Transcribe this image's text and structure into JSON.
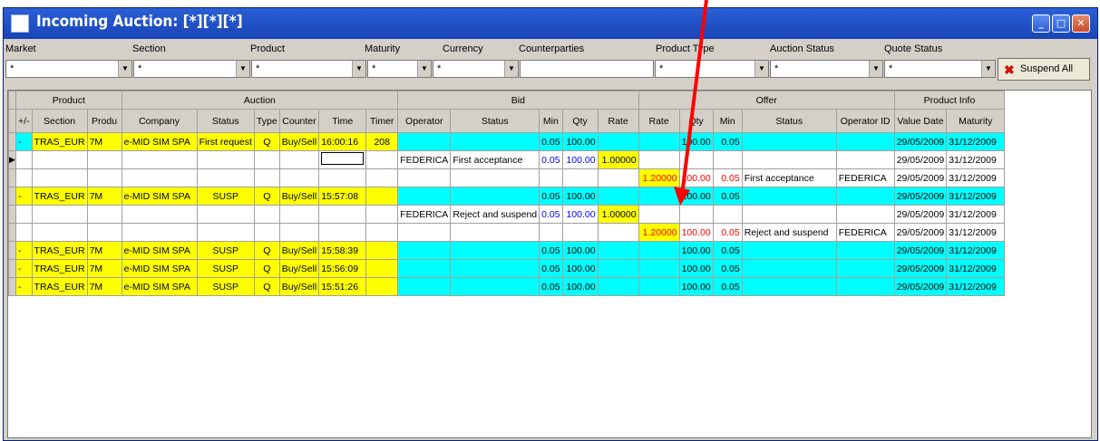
{
  "window": {
    "title": "Incoming Auction: [*][*][*]"
  },
  "filters": [
    {
      "label": "Market",
      "value": "*"
    },
    {
      "label": "Section",
      "value": "*"
    },
    {
      "label": "Product",
      "value": "*"
    },
    {
      "label": "Maturity",
      "value": "*"
    },
    {
      "label": "Currency",
      "value": "*"
    },
    {
      "label": "Counterparties",
      "value": ""
    },
    {
      "label": "Product Type",
      "value": "*"
    },
    {
      "label": "Auction Status",
      "value": "*"
    },
    {
      "label": "Quote Status",
      "value": "*"
    }
  ],
  "suspend_all": "Suspend All",
  "groups": {
    "product": "Product",
    "auction": "Auction",
    "bid": "Bid",
    "offer": "Offer",
    "product_info": "Product Info"
  },
  "columns": [
    "+/-",
    "Section",
    "Produ",
    "Company",
    "Status",
    "Type",
    "Counter",
    "Time",
    "Timer",
    "Operator",
    "Status",
    "Min",
    "Qty",
    "Rate",
    "Rate",
    "Qty",
    "Min",
    "Status",
    "Operator ID",
    "Value Date",
    "Maturity"
  ],
  "rows": [
    {
      "exp": "-",
      "section": "TRAS_EUR",
      "prod": "7M",
      "company": "e-MID SIM SPA",
      "status": "First request",
      "type": "Q",
      "counter": "Buy/Sell",
      "time": "16:00:16",
      "timer": "208",
      "operator": "",
      "bstatus": "",
      "bmin": "0.05",
      "bqty": "100.00",
      "brate": "",
      "orate": "",
      "oqty": "100.00",
      "omin": "0.05",
      "ostatus": "",
      "opid": "",
      "vdate": "29/05/2009",
      "mat": "31/12/2009"
    },
    {
      "exp": "",
      "section": "",
      "prod": "",
      "company": "",
      "status": "",
      "type": "",
      "counter": "",
      "time": "",
      "timer": "",
      "operator": "FEDERICA",
      "bstatus": "First acceptance",
      "bmin": "0.05",
      "bqty": "100.00",
      "brate": "1.00000",
      "orate": "",
      "oqty": "",
      "omin": "",
      "ostatus": "",
      "opid": "",
      "vdate": "29/05/2009",
      "mat": "31/12/2009"
    },
    {
      "exp": "",
      "section": "",
      "prod": "",
      "company": "",
      "status": "",
      "type": "",
      "counter": "",
      "time": "",
      "timer": "",
      "operator": "",
      "bstatus": "",
      "bmin": "",
      "bqty": "",
      "brate": "",
      "orate": "1.20000",
      "oqty": "100.00",
      "omin": "0.05",
      "ostatus": "First acceptance",
      "opid": "FEDERICA",
      "vdate": "29/05/2009",
      "mat": "31/12/2009"
    },
    {
      "exp": "-",
      "section": "TRAS_EUR",
      "prod": "7M",
      "company": "e-MID SIM SPA",
      "status": "SUSP",
      "type": "Q",
      "counter": "Buy/Sell",
      "time": "15:57:08",
      "timer": "",
      "operator": "",
      "bstatus": "",
      "bmin": "0.05",
      "bqty": "100.00",
      "brate": "",
      "orate": "",
      "oqty": "100.00",
      "omin": "0.05",
      "ostatus": "",
      "opid": "",
      "vdate": "29/05/2009",
      "mat": "31/12/2009"
    },
    {
      "exp": "",
      "section": "",
      "prod": "",
      "company": "",
      "status": "",
      "type": "",
      "counter": "",
      "time": "",
      "timer": "",
      "operator": "FEDERICA",
      "bstatus": "Reject and suspend",
      "bmin": "0.05",
      "bqty": "100.00",
      "brate": "1.00000",
      "orate": "",
      "oqty": "",
      "omin": "",
      "ostatus": "",
      "opid": "",
      "vdate": "29/05/2009",
      "mat": "31/12/2009"
    },
    {
      "exp": "",
      "section": "",
      "prod": "",
      "company": "",
      "status": "",
      "type": "",
      "counter": "",
      "time": "",
      "timer": "",
      "operator": "",
      "bstatus": "",
      "bmin": "",
      "bqty": "",
      "brate": "",
      "orate": "1.20000",
      "oqty": "100.00",
      "omin": "0.05",
      "ostatus": "Reject and suspend",
      "opid": "FEDERICA",
      "vdate": "29/05/2009",
      "mat": "31/12/2009"
    },
    {
      "exp": "-",
      "section": "TRAS_EUR",
      "prod": "7M",
      "company": "e-MID SIM SPA",
      "status": "SUSP",
      "type": "Q",
      "counter": "Buy/Sell",
      "time": "15:58:39",
      "timer": "",
      "operator": "",
      "bstatus": "",
      "bmin": "0.05",
      "bqty": "100.00",
      "brate": "",
      "orate": "",
      "oqty": "100.00",
      "omin": "0.05",
      "ostatus": "",
      "opid": "",
      "vdate": "29/05/2009",
      "mat": "31/12/2009"
    },
    {
      "exp": "-",
      "section": "TRAS_EUR",
      "prod": "7M",
      "company": "e-MID SIM SPA",
      "status": "SUSP",
      "type": "Q",
      "counter": "Buy/Sell",
      "time": "15:56:09",
      "timer": "",
      "operator": "",
      "bstatus": "",
      "bmin": "0.05",
      "bqty": "100.00",
      "brate": "",
      "orate": "",
      "oqty": "100.00",
      "omin": "0.05",
      "ostatus": "",
      "opid": "",
      "vdate": "29/05/2009",
      "mat": "31/12/2009"
    },
    {
      "exp": "-",
      "section": "TRAS_EUR",
      "prod": "7M",
      "company": "e-MID SIM SPA",
      "status": "SUSP",
      "type": "Q",
      "counter": "Buy/Sell",
      "time": "15:51:26",
      "timer": "",
      "operator": "",
      "bstatus": "",
      "bmin": "0.05",
      "bqty": "100.00",
      "brate": "",
      "orate": "",
      "oqty": "100.00",
      "omin": "0.05",
      "ostatus": "",
      "opid": "",
      "vdate": "29/05/2009",
      "mat": "31/12/2009"
    }
  ],
  "colors": {
    "cyan": "#00ffff",
    "yellow": "#ffff00",
    "red": "#ff0000",
    "blue": "#0000ff",
    "title_bar": "#1a44b6",
    "annotation_arrow": "#ff0000"
  }
}
